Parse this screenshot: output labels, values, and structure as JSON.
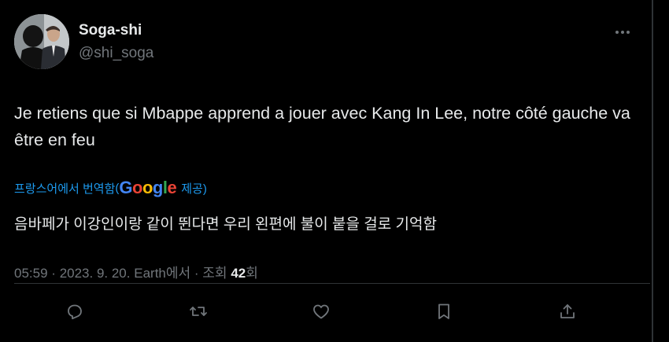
{
  "author": {
    "name": "Soga-shi",
    "handle": "@shi_soga"
  },
  "tweet": {
    "text": "Je retiens que si Mbappe apprend a jouer avec Kang In Lee, notre côté gauche va être en feu",
    "translation_label": "프랑스어에서 번역함",
    "translation_provider": "Google",
    "translation_provider_suffix": "제공)",
    "translation_open_paren": "(",
    "translated_text": "음바페가 이강인이랑 같이 뛴다면 우리 왼편에 불이 붙을 걸로 기억함"
  },
  "meta": {
    "time": "05:59",
    "date": "2023. 9. 20.",
    "source": "Earth에서",
    "views_label": "조회",
    "views_count": "42",
    "views_suffix": "회",
    "separator": "·"
  },
  "icons": {
    "more": "more-horizontal-icon",
    "reply": "reply-icon",
    "retweet": "retweet-icon",
    "like": "heart-icon",
    "bookmark": "bookmark-icon",
    "share": "share-icon"
  },
  "colors": {
    "background": "#000000",
    "text": "#e7e9ea",
    "muted": "#71767b",
    "link": "#1d9bf0",
    "divider": "#2f3336"
  }
}
